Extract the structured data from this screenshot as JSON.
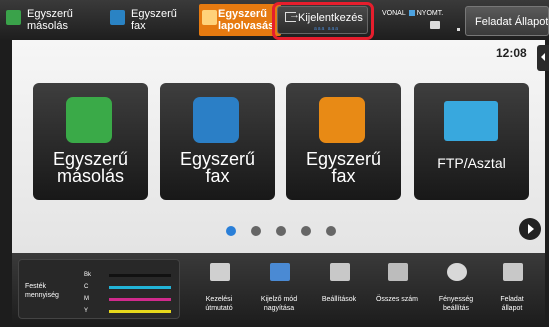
{
  "topbar": {
    "copy": {
      "icon": "copy-icon",
      "label": "Egyszerű\nmásolás"
    },
    "fax": {
      "icon": "fax-icon",
      "label": "Egyszerű\nfax"
    },
    "scan": {
      "icon": "scan-icon",
      "label": "Egyszerű\nlapolvasás"
    },
    "login": {
      "icon": "login-icon",
      "label": "Kijelentkezés",
      "sub": "aaa aaa"
    },
    "status_line": "VONAL",
    "status_print": "NYOMT.",
    "job_status": "Feladat Állapot"
  },
  "clock": "12:08",
  "tiles": [
    {
      "icon": "copy-icon",
      "label": "Egyszerű\nmásolás"
    },
    {
      "icon": "fax-icon",
      "label": "Egyszerű\nfax"
    },
    {
      "icon": "scan-icon",
      "label": "Egyszerű\nfax"
    },
    {
      "icon": "monitor-icon",
      "label": "FTP/Asztal"
    }
  ],
  "pagination": {
    "page_count": 5,
    "current": 1
  },
  "toner": {
    "label": "Festék\nmennyiség",
    "levels": [
      {
        "name": "Bk",
        "color": "#111111",
        "level": 1.0
      },
      {
        "name": "C",
        "color": "#22b4d8",
        "level": 1.0
      },
      {
        "name": "M",
        "color": "#d02a8c",
        "level": 1.0
      },
      {
        "name": "Y",
        "color": "#e6d81c",
        "level": 1.0
      }
    ]
  },
  "bottom_items": [
    {
      "icon": "manual-icon",
      "label": "Kezelési\nútmutató"
    },
    {
      "icon": "zoom-display-icon",
      "label": "Kijelző mód\nnagyítása"
    },
    {
      "icon": "settings-icon",
      "label": "Beállítások"
    },
    {
      "icon": "counter-icon",
      "label": "Összes szám"
    },
    {
      "icon": "brightness-icon",
      "label": "Fényesség\nbeállítás"
    },
    {
      "icon": "job-status-icon",
      "label": "Feladat\nállapot"
    }
  ],
  "colors": {
    "accent_blue": "#2a7fd8",
    "highlight_red": "#e61e2d",
    "scan_orange": "#e67a10"
  }
}
